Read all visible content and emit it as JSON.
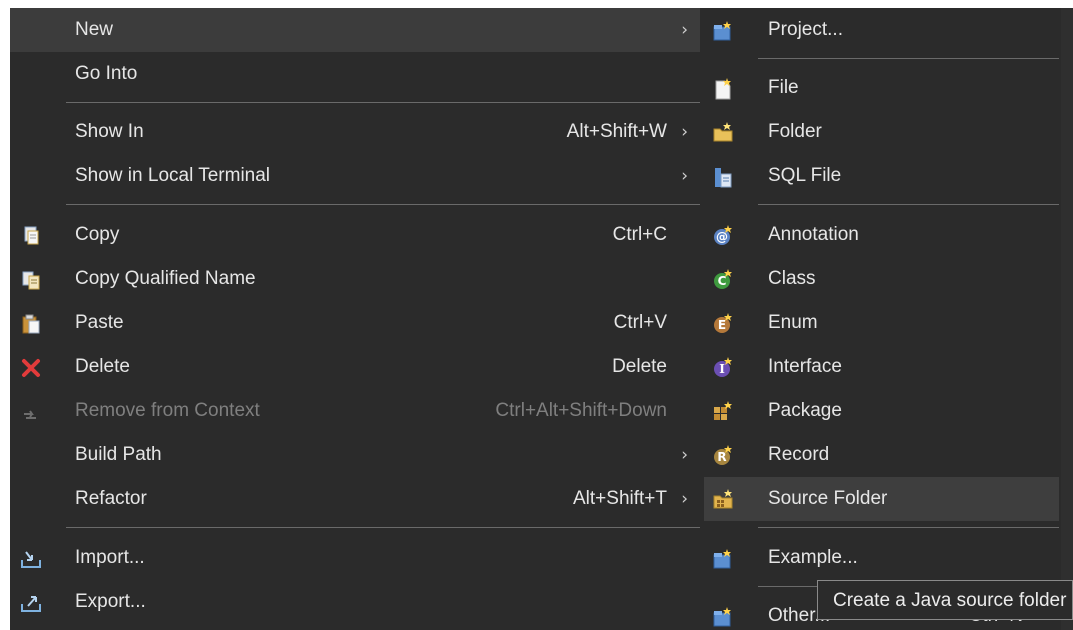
{
  "main_menu": {
    "items": [
      {
        "label": "New",
        "shortcut": "",
        "submenu": true
      },
      {
        "label": "Go Into",
        "shortcut": "",
        "submenu": false
      },
      {
        "label": "Show In",
        "shortcut": "Alt+Shift+W",
        "submenu": true
      },
      {
        "label": "Show in Local Terminal",
        "shortcut": "",
        "submenu": true
      },
      {
        "label": "Copy",
        "shortcut": "Ctrl+C",
        "submenu": false
      },
      {
        "label": "Copy Qualified Name",
        "shortcut": "",
        "submenu": false
      },
      {
        "label": "Paste",
        "shortcut": "Ctrl+V",
        "submenu": false
      },
      {
        "label": "Delete",
        "shortcut": "Delete",
        "submenu": false
      },
      {
        "label": "Remove from Context",
        "shortcut": "Ctrl+Alt+Shift+Down",
        "submenu": false,
        "disabled": true
      },
      {
        "label": "Build Path",
        "shortcut": "",
        "submenu": true
      },
      {
        "label": "Refactor",
        "shortcut": "Alt+Shift+T",
        "submenu": true
      },
      {
        "label": "Import...",
        "shortcut": "",
        "submenu": false
      },
      {
        "label": "Export...",
        "shortcut": "",
        "submenu": false
      }
    ]
  },
  "sub_menu": {
    "items": [
      {
        "label": "Project...",
        "icon": "new-project-icon"
      },
      {
        "label": "File",
        "icon": "new-file-icon"
      },
      {
        "label": "Folder",
        "icon": "new-folder-icon"
      },
      {
        "label": "SQL File",
        "icon": "sql-file-icon"
      },
      {
        "label": "Annotation",
        "icon": "new-annotation-icon"
      },
      {
        "label": "Class",
        "icon": "new-class-icon"
      },
      {
        "label": "Enum",
        "icon": "new-enum-icon"
      },
      {
        "label": "Interface",
        "icon": "new-interface-icon"
      },
      {
        "label": "Package",
        "icon": "new-package-icon"
      },
      {
        "label": "Record",
        "icon": "new-record-icon"
      },
      {
        "label": "Source Folder",
        "icon": "new-source-folder-icon"
      },
      {
        "label": "Example...",
        "icon": "new-example-icon"
      },
      {
        "label": "Other...",
        "shortcut": "Ctrl+N",
        "icon": "new-other-icon"
      }
    ]
  },
  "tooltip": {
    "text": "Create a Java source folder"
  },
  "colors": {
    "menu_bg": "#2b2b2b",
    "highlight": "#3c3c3c",
    "text": "#e6e6e6",
    "disabled_text": "#7f7f7f",
    "separator": "#6a6a6a"
  }
}
